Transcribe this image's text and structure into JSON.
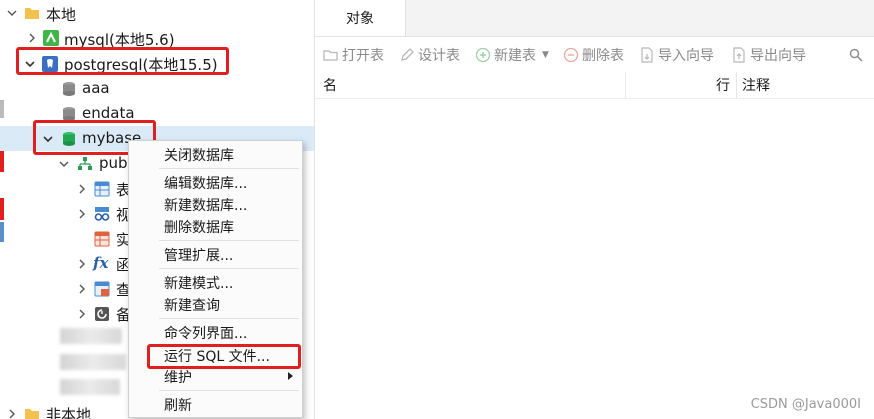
{
  "tree": {
    "local_group": "本地",
    "mysql_conn": "mysql(本地5.6)",
    "pg_conn": "postgresql(本地15.5)",
    "db_aaa": "aaa",
    "db_endata": "endata",
    "db_mybase": "mybase",
    "schema_public": "pub",
    "node_tables": "表",
    "node_views": "视",
    "node_mviews": "实",
    "node_functions": "函",
    "node_queries": "查",
    "node_backups": "备",
    "remote_group": "非本地"
  },
  "tabs": [
    {
      "label": "对象"
    }
  ],
  "toolbar": {
    "open_table": "打开表",
    "design_table": "设计表",
    "new_table": "新建表",
    "delete_table": "删除表",
    "import_wizard": "导入向导",
    "export_wizard": "导出向导"
  },
  "columns": {
    "name": "名",
    "rows": "行",
    "comment": "注释"
  },
  "context_menu": [
    "关闭数据库",
    "编辑数据库...",
    "新建数据库...",
    "删除数据库",
    "管理扩展...",
    "新建模式...",
    "新建查询",
    "命令列界面...",
    "运行 SQL 文件...",
    "维护",
    "刷新"
  ],
  "watermark": "CSDN @Java000I",
  "colors": {
    "highlight_box": "#e02020",
    "selected_row": "#dbeaf7",
    "folder": "#f2c14e"
  }
}
